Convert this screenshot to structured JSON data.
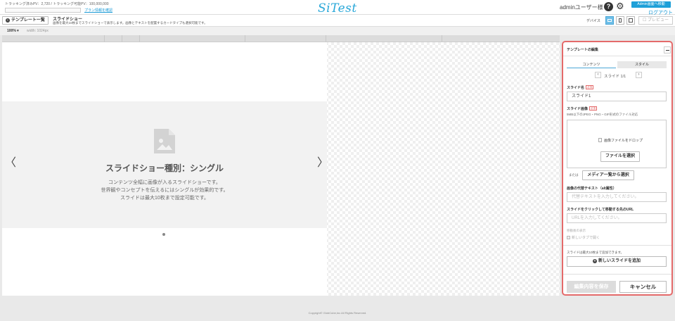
{
  "header": {
    "pv_text": "トラッキング済みPV：2,720 / トラッキング可能PV：100,000,000",
    "plan_link": "プラン情報を確認",
    "logo": "SiTest",
    "user_name": "adminユーザー様",
    "admin_button": "Admin画面へ移動",
    "logout": "ログアウト"
  },
  "subheader": {
    "back_button": "テンプレート一覧",
    "template_title": "スライドショー",
    "template_desc": "画像を最大10枚までスライドショーで表示します。画像とテキストを配置するカードタイプも選択可能です。",
    "device_label": "デバイス",
    "preview_button": "プレビュー"
  },
  "zoom": {
    "level": "100% ▾",
    "width_label": "width: 1024px"
  },
  "slide": {
    "heading": "スライドショー種別：シングル",
    "lines": [
      "コンテンツ全幅に画像が入るスライドショーです。",
      "世界観やコンセプトを伝えるにはシングルが効果的です。",
      "スライドは最大10枚まで設定可能です。"
    ],
    "prev_arrow": "〈",
    "next_arrow": "〉"
  },
  "footer": "Copyright© GlobCube,Inc All Rights Reserved.",
  "panel": {
    "title": "テンプレートの編集",
    "tabs": [
      "コンテンツ",
      "スタイル"
    ],
    "pager": "スライド 1/1",
    "slide_name_label": "スライド名",
    "required": "必須",
    "slide_name_value": "スライド1",
    "slide_image_label": "スライド画像",
    "slide_image_note": "5MB以下のJPEG・PNG・GIF形式のファイル対応",
    "drop_text": "画像ファイルをドロップ",
    "file_button": "ファイルを選択",
    "or_label": "または",
    "media_button": "メディア一覧から選択",
    "alt_label": "画像の代替テキスト（alt属性）",
    "alt_placeholder": "代替テキストを入力してください。",
    "url_label": "スライドをクリックして移動する先のURL",
    "url_placeholder": "URLを入力してください。",
    "link_target_label": "移動後の表示",
    "new_tab_label": "新しいタブで開く",
    "add_note": "スライドは最大10枚まで追加できます。",
    "add_button": "新しいスライドを追加",
    "save_button": "編集内容を保存",
    "cancel_button": "キャンセル"
  },
  "colors": {
    "accent": "#1fa0d8",
    "panel_border": "#e46a6a"
  }
}
